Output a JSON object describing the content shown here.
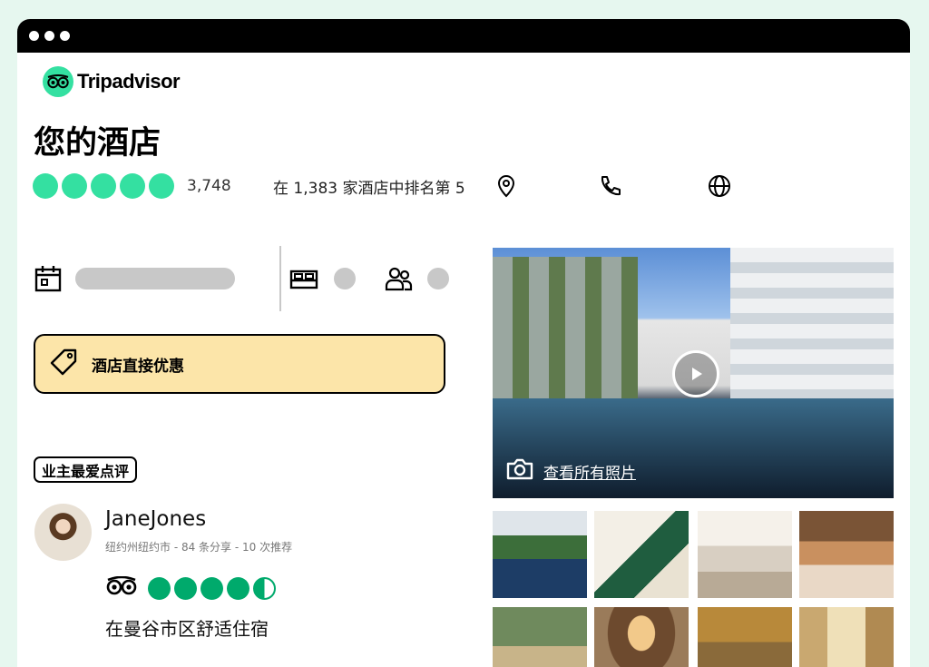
{
  "brand": {
    "name": "Tripadvisor",
    "accent": "#34e0a1"
  },
  "hotel": {
    "title": "您的酒店",
    "rating_bubbles": 5,
    "review_count": "3,748",
    "rank": "在 1,383 家酒店中排名第 5"
  },
  "deal": {
    "label": "酒店直接优惠",
    "bg": "#fce5a9"
  },
  "owner_badge": "业主最爱点评",
  "review": {
    "name": "JaneJones",
    "meta": "纽约州纽约市 - 84 条分享 - 10 次推荐",
    "rating": 4.5,
    "title": "在曼谷市区舒适住宿"
  },
  "gallery": {
    "all_photos_label": "查看所有照片"
  },
  "icons": [
    "location-icon",
    "phone-icon",
    "globe-icon",
    "calendar-icon",
    "bed-icon",
    "guests-icon",
    "tag-icon",
    "camera-icon",
    "play-icon",
    "owl-icon"
  ]
}
